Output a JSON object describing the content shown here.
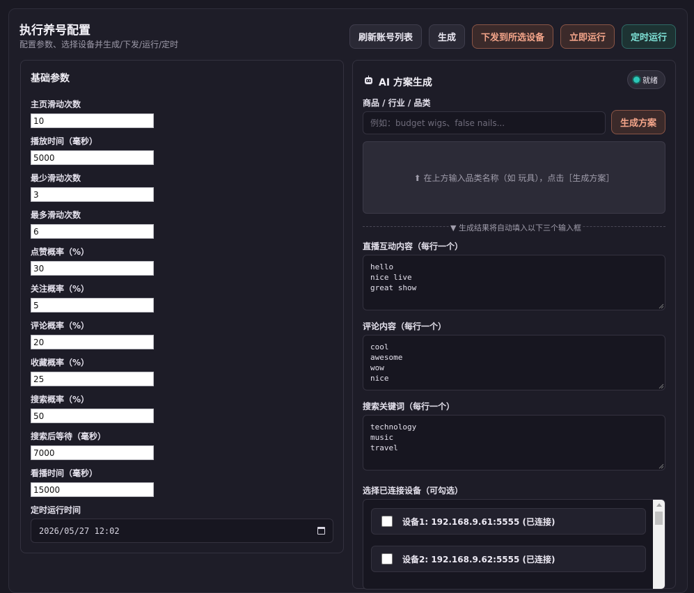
{
  "header": {
    "title": "执行养号配置",
    "subtitle": "配置参数、选择设备并生成/下发/运行/定时"
  },
  "toolbar": {
    "refresh_label": "刷新账号列表",
    "generate_label": "生成",
    "dispatch_label": "下发到所选设备",
    "run_now_label": "立即运行",
    "schedule_label": "定时运行"
  },
  "basic": {
    "title": "基础参数",
    "fields": [
      {
        "label": "主页滑动次数",
        "value": "10"
      },
      {
        "label": "播放时间（毫秒）",
        "value": "5000"
      },
      {
        "label": "最少滑动次数",
        "value": "3"
      },
      {
        "label": "最多滑动次数",
        "value": "6"
      },
      {
        "label": "点赞概率（%）",
        "value": "30"
      },
      {
        "label": "关注概率（%）",
        "value": "5"
      },
      {
        "label": "评论概率（%）",
        "value": "20"
      },
      {
        "label": "收藏概率（%）",
        "value": "25"
      },
      {
        "label": "搜索概率（%）",
        "value": "50"
      },
      {
        "label": "搜索后等待（毫秒）",
        "value": "7000"
      },
      {
        "label": "看播时间（毫秒）",
        "value": "15000"
      }
    ],
    "schedule_label": "定时运行时间",
    "schedule_value": "2026/05/27  12:02"
  },
  "ai": {
    "title": "AI 方案生成",
    "status": "就绪",
    "status_color": "#2cc7b8",
    "category_label": "商品 / 行业 / 品类",
    "category_placeholder": "例如：budget wigs、false nails...",
    "generate_plan_label": "生成方案",
    "hint": "⬆ 在上方输入品类名称（如 玩具），点击［生成方案］",
    "divider": "▼ 生成结果将自动填入以下三个输入框",
    "live_label": "直播互动内容（每行一个）",
    "live_value": "hello\nnice live\ngreat show",
    "comment_label": "评论内容（每行一个）",
    "comment_value": "cool\nawesome\nwow\nnice",
    "keyword_label": "搜索关键词（每行一个）",
    "keyword_value": "technology\nmusic\ntravel"
  },
  "devices": {
    "label": "选择已连接设备（可勾选）",
    "items": [
      {
        "name": "设备1: 192.168.9.61:5555 (已连接)",
        "checked": false
      },
      {
        "name": "设备2: 192.168.9.62:5555 (已连接)",
        "checked": false
      }
    ]
  }
}
